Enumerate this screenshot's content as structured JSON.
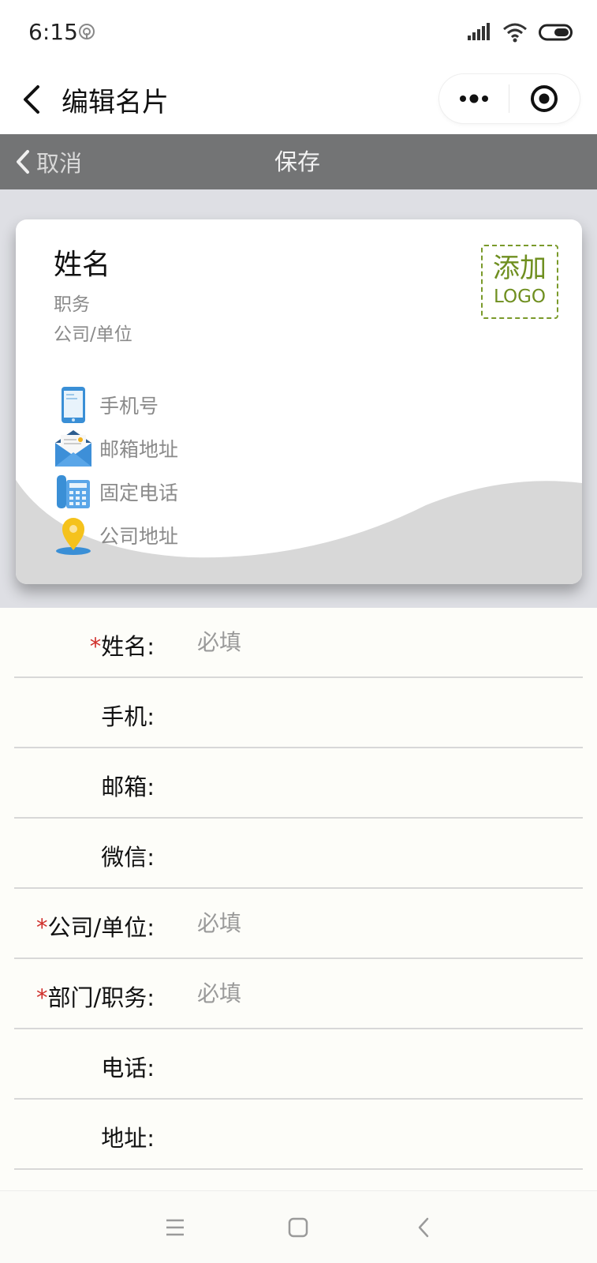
{
  "status_bar": {
    "time": "6:15"
  },
  "nav": {
    "title": "编辑名片"
  },
  "action_bar": {
    "cancel_label": "取消",
    "save_label": "保存"
  },
  "card": {
    "name": "姓名",
    "job_title": "职务",
    "company": "公司/单位",
    "logo_line1": "添加",
    "logo_line2": "LOGO",
    "rows": [
      {
        "icon": "phone-icon",
        "label": "手机号"
      },
      {
        "icon": "mail-icon",
        "label": "邮箱地址"
      },
      {
        "icon": "telephone-icon",
        "label": "固定电话"
      },
      {
        "icon": "location-pin-icon",
        "label": "公司地址"
      }
    ]
  },
  "form": {
    "fields": [
      {
        "required": true,
        "label": "姓名:",
        "placeholder": "必填",
        "value": ""
      },
      {
        "required": false,
        "label": "手机:",
        "placeholder": "",
        "value": ""
      },
      {
        "required": false,
        "label": "邮箱:",
        "placeholder": "",
        "value": ""
      },
      {
        "required": false,
        "label": "微信:",
        "placeholder": "",
        "value": ""
      },
      {
        "required": true,
        "label": "公司/单位:",
        "placeholder": "必填",
        "value": ""
      },
      {
        "required": true,
        "label": "部门/职务:",
        "placeholder": "必填",
        "value": ""
      },
      {
        "required": false,
        "label": "电话:",
        "placeholder": "",
        "value": ""
      },
      {
        "required": false,
        "label": "地址:",
        "placeholder": "",
        "value": ""
      }
    ],
    "required_mark": "*"
  },
  "colors": {
    "action_bar_bg": "#737475",
    "card_area_bg": "#dedfe4",
    "logo_accent": "#6f8f20",
    "required_mark": "#d0302b"
  }
}
